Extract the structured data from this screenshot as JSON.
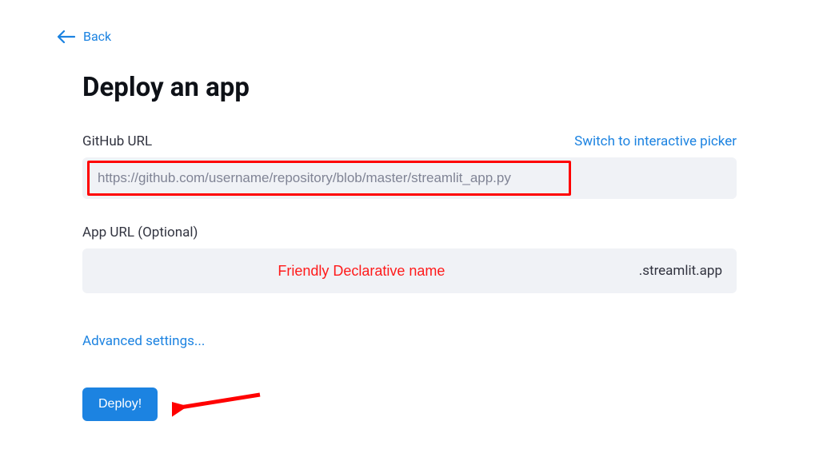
{
  "nav": {
    "back_label": "Back"
  },
  "title": "Deploy an app",
  "github_field": {
    "label": "GitHub URL",
    "placeholder": "https://github.com/username/repository/blob/master/streamlit_app.py",
    "switch_link": "Switch to interactive picker"
  },
  "app_url_field": {
    "label": "App URL (Optional)",
    "annotation_placeholder": "Friendly Declarative name",
    "suffix": ".streamlit.app"
  },
  "advanced_link": "Advanced settings...",
  "deploy_button": "Deploy!",
  "colors": {
    "link": "#1c83e1",
    "primary": "#1c83e1",
    "highlight": "#ff0000"
  }
}
